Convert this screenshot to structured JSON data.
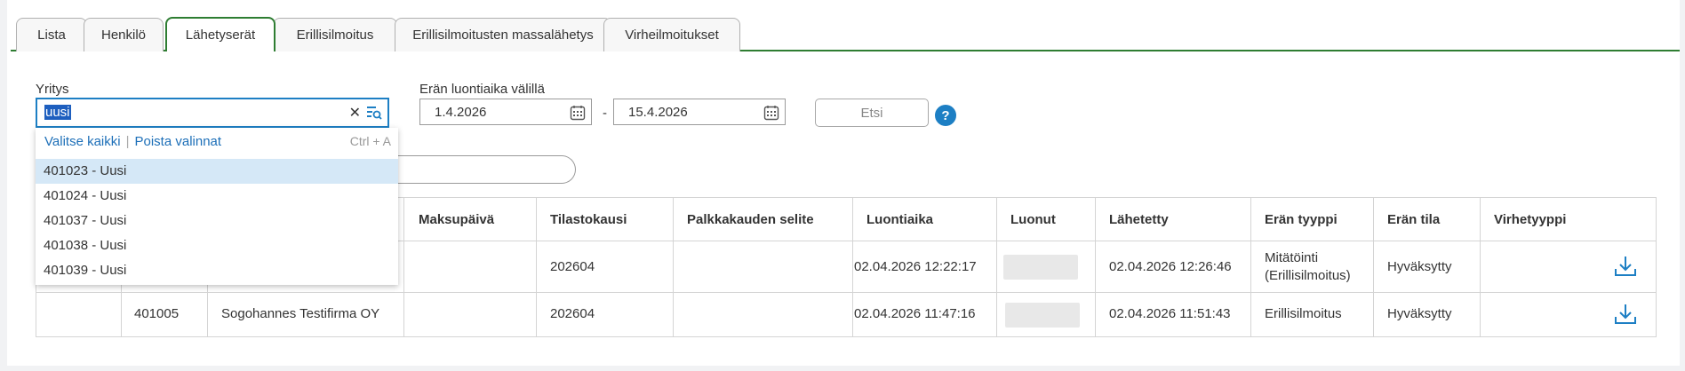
{
  "tabs": [
    {
      "label": "Lista",
      "active": false
    },
    {
      "label": "Henkilö",
      "active": false
    },
    {
      "label": "Lähetyserät",
      "active": true
    },
    {
      "label": "Erillisilmoitus",
      "active": false
    },
    {
      "label": "Erillisilmoitusten massalähetys",
      "active": false
    },
    {
      "label": "Virheilmoitukset",
      "active": false
    }
  ],
  "filters": {
    "company_label": "Yritys",
    "company_value": "uusi",
    "date_label": "Erän luontiaika välillä",
    "date_from": "1.4.2026",
    "date_separator": "-",
    "date_to": "15.4.2026",
    "search_button": "Etsi",
    "help": "?"
  },
  "dropdown": {
    "select_all": "Valitse kaikki",
    "separator": "|",
    "clear_selection": "Poista valinnat",
    "shortcut": "Ctrl + A",
    "options": [
      "401023 - Uusi",
      "401024 - Uusi",
      "401037 - Uusi",
      "401038 - Uusi",
      "401039 - Uusi"
    ],
    "highlighted_index": 0
  },
  "table": {
    "columns": [
      "Maksupäivä",
      "Tilastokausi",
      "Palkkakauden selite",
      "Luontiaika",
      "Luonut",
      "Lähetetty",
      "Erän tyyppi",
      "Erän tila",
      "Virhetyyppi"
    ],
    "rows": [
      {
        "id": "",
        "company": "",
        "payday": "",
        "period": "202604",
        "period_desc": "",
        "created": "02.04.2026 12:22:17",
        "sent": "02.04.2026 12:26:46",
        "type_line1": "Mitätöinti",
        "type_line2": "(Erillisilmoitus)",
        "status": "Hyväksytty",
        "error": ""
      },
      {
        "id": "401005",
        "company": "Sogohannes Testifirma OY",
        "payday": "",
        "period": "202604",
        "period_desc": "",
        "created": "02.04.2026 11:47:16",
        "sent": "02.04.2026 11:51:43",
        "type_line1": "Erillisilmoitus",
        "type_line2": "",
        "status": "Hyväksytty",
        "error": ""
      }
    ]
  },
  "colors": {
    "accent": "#2e7d32",
    "link": "#1d6fb8",
    "focus": "#1d7fc4",
    "highlight": "#d5e8f7"
  }
}
